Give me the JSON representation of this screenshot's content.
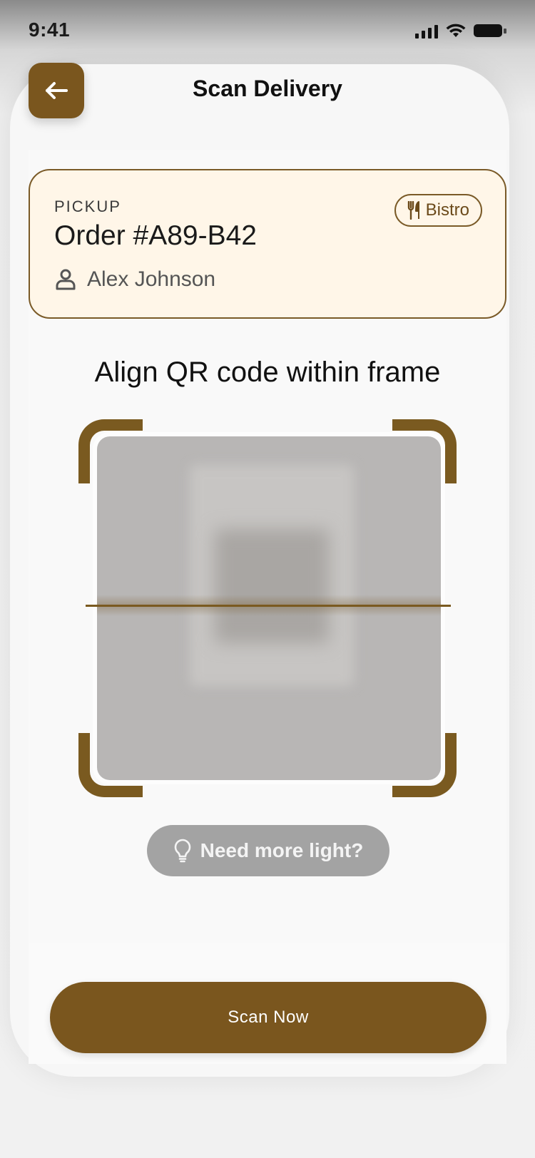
{
  "status_bar": {
    "time": "9:41"
  },
  "header": {
    "title": "Scan Delivery",
    "back_icon": "arrow-left-icon"
  },
  "order": {
    "type_label": "PICKUP",
    "number": "Order #A89-B42",
    "customer_name": "Alex Johnson",
    "vendor_label": "Bistro",
    "vendor_icon": "utensils-icon"
  },
  "scanner": {
    "instruction": "Align QR code within frame"
  },
  "light_hint": {
    "label": "Need more light?",
    "icon": "lightbulb-icon"
  },
  "action": {
    "scan_label": "Scan Now"
  },
  "colors": {
    "accent": "#7a561e",
    "card_bg": "#fff6e8",
    "hint_bg": "#a3a3a3"
  }
}
